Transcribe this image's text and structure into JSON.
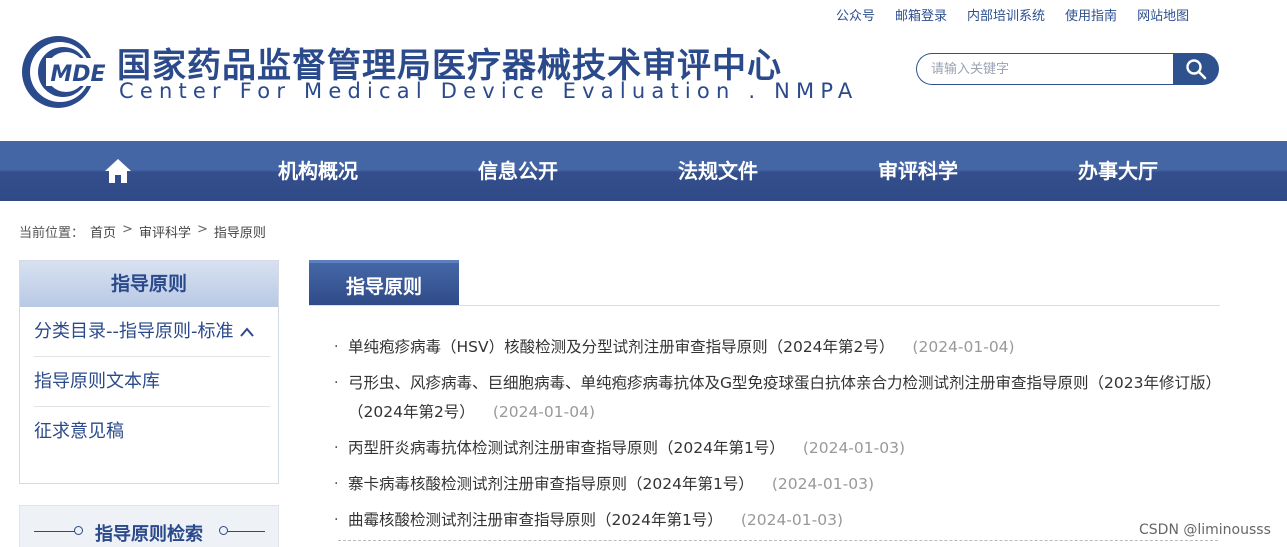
{
  "top_links": [
    "公众号",
    "邮箱登录",
    "内部培训系统",
    "使用指南",
    "网站地图"
  ],
  "logo_text": "MDE",
  "title_cn": "国家药品监督管理局医疗器械技术审评中心",
  "title_en": "Center For Medical Device Evaluation . NMPA",
  "search": {
    "placeholder": "请输入关键字"
  },
  "nav": [
    "机构概况",
    "信息公开",
    "法规文件",
    "审评科学",
    "办事大厅"
  ],
  "breadcrumb": {
    "label": "当前位置：",
    "items": [
      "首页",
      "审评科学",
      "指导原则"
    ],
    "sep": ">"
  },
  "sidebar": {
    "title": "指导原则",
    "items": [
      {
        "label": "分类目录--指导原则-标准"
      },
      {
        "label": "指导原则文本库"
      },
      {
        "label": "征求意见稿"
      }
    ],
    "search_title": "指导原则检索"
  },
  "main": {
    "tab": "指导原则",
    "articles": [
      {
        "title": "单纯疱疹病毒（HSV）核酸检测及分型试剂注册审查指导原则（2024年第2号）",
        "date": "(2024-01-04)"
      },
      {
        "title": "弓形虫、风疹病毒、巨细胞病毒、单纯疱疹病毒抗体及G型免疫球蛋白抗体亲合力检测试剂注册审查指导原则（2023年修订版）（2024年第2号）",
        "date": "(2024-01-04)"
      },
      {
        "title": "丙型肝炎病毒抗体检测试剂注册审查指导原则（2024年第1号）",
        "date": "(2024-01-03)"
      },
      {
        "title": "寨卡病毒核酸检测试剂注册审查指导原则（2024年第1号）",
        "date": "(2024-01-03)"
      },
      {
        "title": "曲霉核酸检测试剂注册审查指导原则（2024年第1号）",
        "date": "(2024-01-03)"
      }
    ]
  },
  "watermark": "CSDN @liminousss",
  "colors": {
    "brand": "#2b4a8c",
    "nav": "#3a5a99",
    "date": "#999999"
  }
}
